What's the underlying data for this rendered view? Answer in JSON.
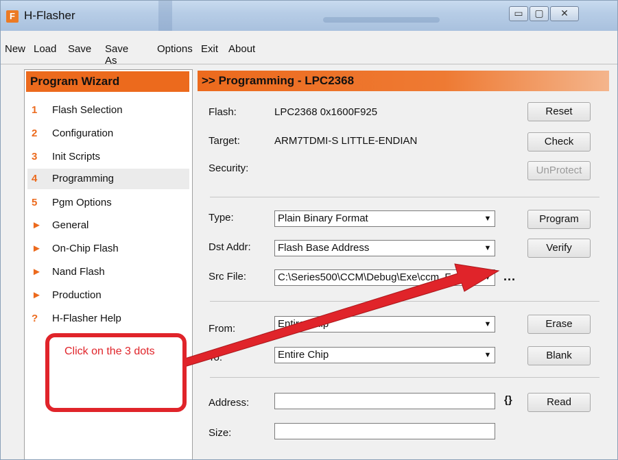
{
  "window": {
    "title": "H-Flasher",
    "minimize": "▭",
    "maximize": "▢",
    "close": "✕",
    "app_icon_letter": "F"
  },
  "menu": [
    "New",
    "Load",
    "Save",
    "Save As",
    "Options",
    "Exit",
    "About"
  ],
  "wizard": {
    "title": "Program Wizard",
    "items": [
      {
        "marker": "1",
        "label": "Flash Selection"
      },
      {
        "marker": "2",
        "label": "Configuration"
      },
      {
        "marker": "3",
        "label": "Init Scripts"
      },
      {
        "marker": "4",
        "label": "Programming"
      },
      {
        "marker": "5",
        "label": "Pgm Options"
      },
      {
        "marker": "►",
        "label": "General"
      },
      {
        "marker": "►",
        "label": "On-Chip Flash"
      },
      {
        "marker": "►",
        "label": "Nand Flash"
      },
      {
        "marker": "►",
        "label": "Production"
      },
      {
        "marker": "?",
        "label": "H-Flasher Help"
      }
    ]
  },
  "programming": {
    "header": ">> Programming - LPC2368",
    "flash_label": "Flash:",
    "flash_value": "LPC2368  0x1600F925",
    "target_label": "Target:",
    "target_value": "ARM7TDMI-S  LITTLE-ENDIAN",
    "security_label": "Security:",
    "buttons": {
      "reset": "Reset",
      "check": "Check",
      "unprotect": "UnProtect",
      "program": "Program",
      "verify": "Verify",
      "erase": "Erase",
      "blank": "Blank",
      "read": "Read"
    },
    "type_label": "Type:",
    "type_value": "Plain Binary Format",
    "dst_label": "Dst Addr:",
    "dst_value": "Flash Base Address",
    "src_label": "Src File:",
    "src_value": "C:\\Series500\\CCM\\Debug\\Exe\\ccm_F",
    "browse": "...",
    "from_label": "From:",
    "from_value": "Entire Chip",
    "to_label": "To:",
    "to_value": "Entire Chip",
    "address_label": "Address:",
    "address_value": "",
    "size_label": "Size:",
    "size_value": "",
    "curly_glyph": "{}"
  },
  "annotation": {
    "text": "Click on the 3 dots",
    "color": "#e0242a"
  },
  "colors": {
    "accent": "#ec6a1d",
    "annotation": "#e0242a"
  }
}
